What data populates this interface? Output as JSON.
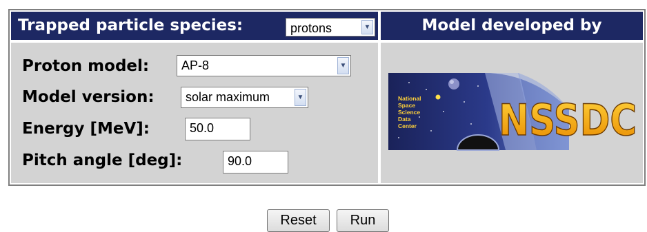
{
  "header": {
    "species_label": "Trapped particle species:",
    "species_value": "protons",
    "developer_title": "Model developed by"
  },
  "form": {
    "proton_model_label": "Proton model:",
    "proton_model_value": "AP-8",
    "model_version_label": "Model version:",
    "model_version_value": "solar maximum",
    "energy_label": "Energy [MeV]:",
    "energy_value": "50.0",
    "pitch_label": "Pitch angle [deg]:",
    "pitch_value": "90.0"
  },
  "logo": {
    "small_text": [
      "National",
      "Space",
      "Science",
      "Data",
      "Center"
    ],
    "big_text": "NSSDC"
  },
  "buttons": {
    "reset": "Reset",
    "run": "Run"
  },
  "icons": {
    "dropdown": "chevron-down-icon"
  },
  "colors": {
    "header_bg": "#1d2863",
    "panel_bg": "#d3d3d3",
    "logo_text": "#f2a400"
  }
}
